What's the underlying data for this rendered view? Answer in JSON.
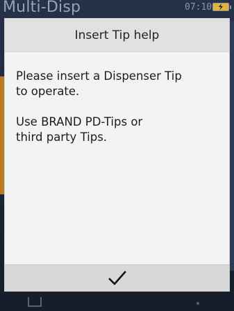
{
  "status_bar": {
    "app_title": "Multi-Disp",
    "time": "07:10",
    "battery_icon": "battery-charging-icon"
  },
  "dialog": {
    "title": "Insert Tip help",
    "paragraphs": [
      "Please insert a Dispenser Tip\nto operate.",
      "Use BRAND PD-Tips or\nthird party Tips."
    ],
    "confirm_icon": "checkmark-icon"
  },
  "bottom_nav": {
    "left_icon": "tray-icon",
    "right_icon": "dot-icon"
  },
  "colors": {
    "dialog_bg": "#f3f3f3",
    "header_bg": "#e1e1e1",
    "footer_bg": "#d8d8d8",
    "battery": "#e3b23c",
    "accent": "#b87a24"
  }
}
